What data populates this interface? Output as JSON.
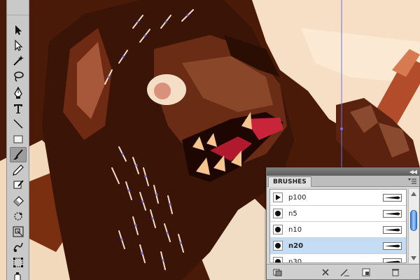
{
  "app": {
    "accent_color": "#c4dcf4",
    "guide_color": "#6b74e8"
  },
  "tools": [
    {
      "name": "selection-tool",
      "icon": "arrow-icon"
    },
    {
      "name": "direct-selection-tool",
      "icon": "hollow-arrow-icon"
    },
    {
      "name": "magic-wand-tool",
      "icon": "magic-wand-icon"
    },
    {
      "name": "lasso-tool",
      "icon": "lasso-icon"
    },
    {
      "name": "pen-tool",
      "icon": "pen-icon"
    },
    {
      "name": "type-tool",
      "icon": "type-icon"
    },
    {
      "name": "line-tool",
      "icon": "line-icon"
    },
    {
      "name": "rectangle-tool",
      "icon": "rectangle-icon"
    },
    {
      "name": "paintbrush-tool",
      "icon": "paintbrush-icon",
      "active": true
    },
    {
      "name": "pencil-tool",
      "icon": "pencil-icon"
    },
    {
      "name": "blob-brush-tool",
      "icon": "blob-brush-icon"
    },
    {
      "name": "eraser-tool",
      "icon": "eraser-icon"
    },
    {
      "name": "rotate-tool",
      "icon": "rotate-icon"
    },
    {
      "name": "scale-tool",
      "icon": "scale-icon"
    },
    {
      "name": "warp-tool",
      "icon": "warp-icon"
    },
    {
      "name": "free-transform-tool",
      "icon": "free-transform-icon"
    },
    {
      "name": "symbol-sprayer-tool",
      "icon": "symbol-sprayer-icon"
    }
  ],
  "brushes_panel": {
    "tab_label": "BRUSHES",
    "items": [
      {
        "label": "p100",
        "thumb": "triangle-brush-icon"
      },
      {
        "label": "n5",
        "thumb": "circle-brush-icon"
      },
      {
        "label": "n10",
        "thumb": "circle-brush-icon"
      },
      {
        "label": "n20",
        "thumb": "circle-brush-icon",
        "selected": true
      },
      {
        "label": "n30",
        "thumb": "circle-brush-icon"
      }
    ],
    "bottom_buttons": [
      {
        "name": "brush-libraries-button",
        "icon": "library-icon"
      },
      {
        "name": "remove-brush-stroke-button",
        "icon": "remove-stroke-icon"
      },
      {
        "name": "brush-options-button",
        "icon": "options-icon"
      },
      {
        "name": "new-brush-button",
        "icon": "new-brush-icon"
      },
      {
        "name": "delete-brush-button",
        "icon": "trash-icon"
      }
    ]
  }
}
